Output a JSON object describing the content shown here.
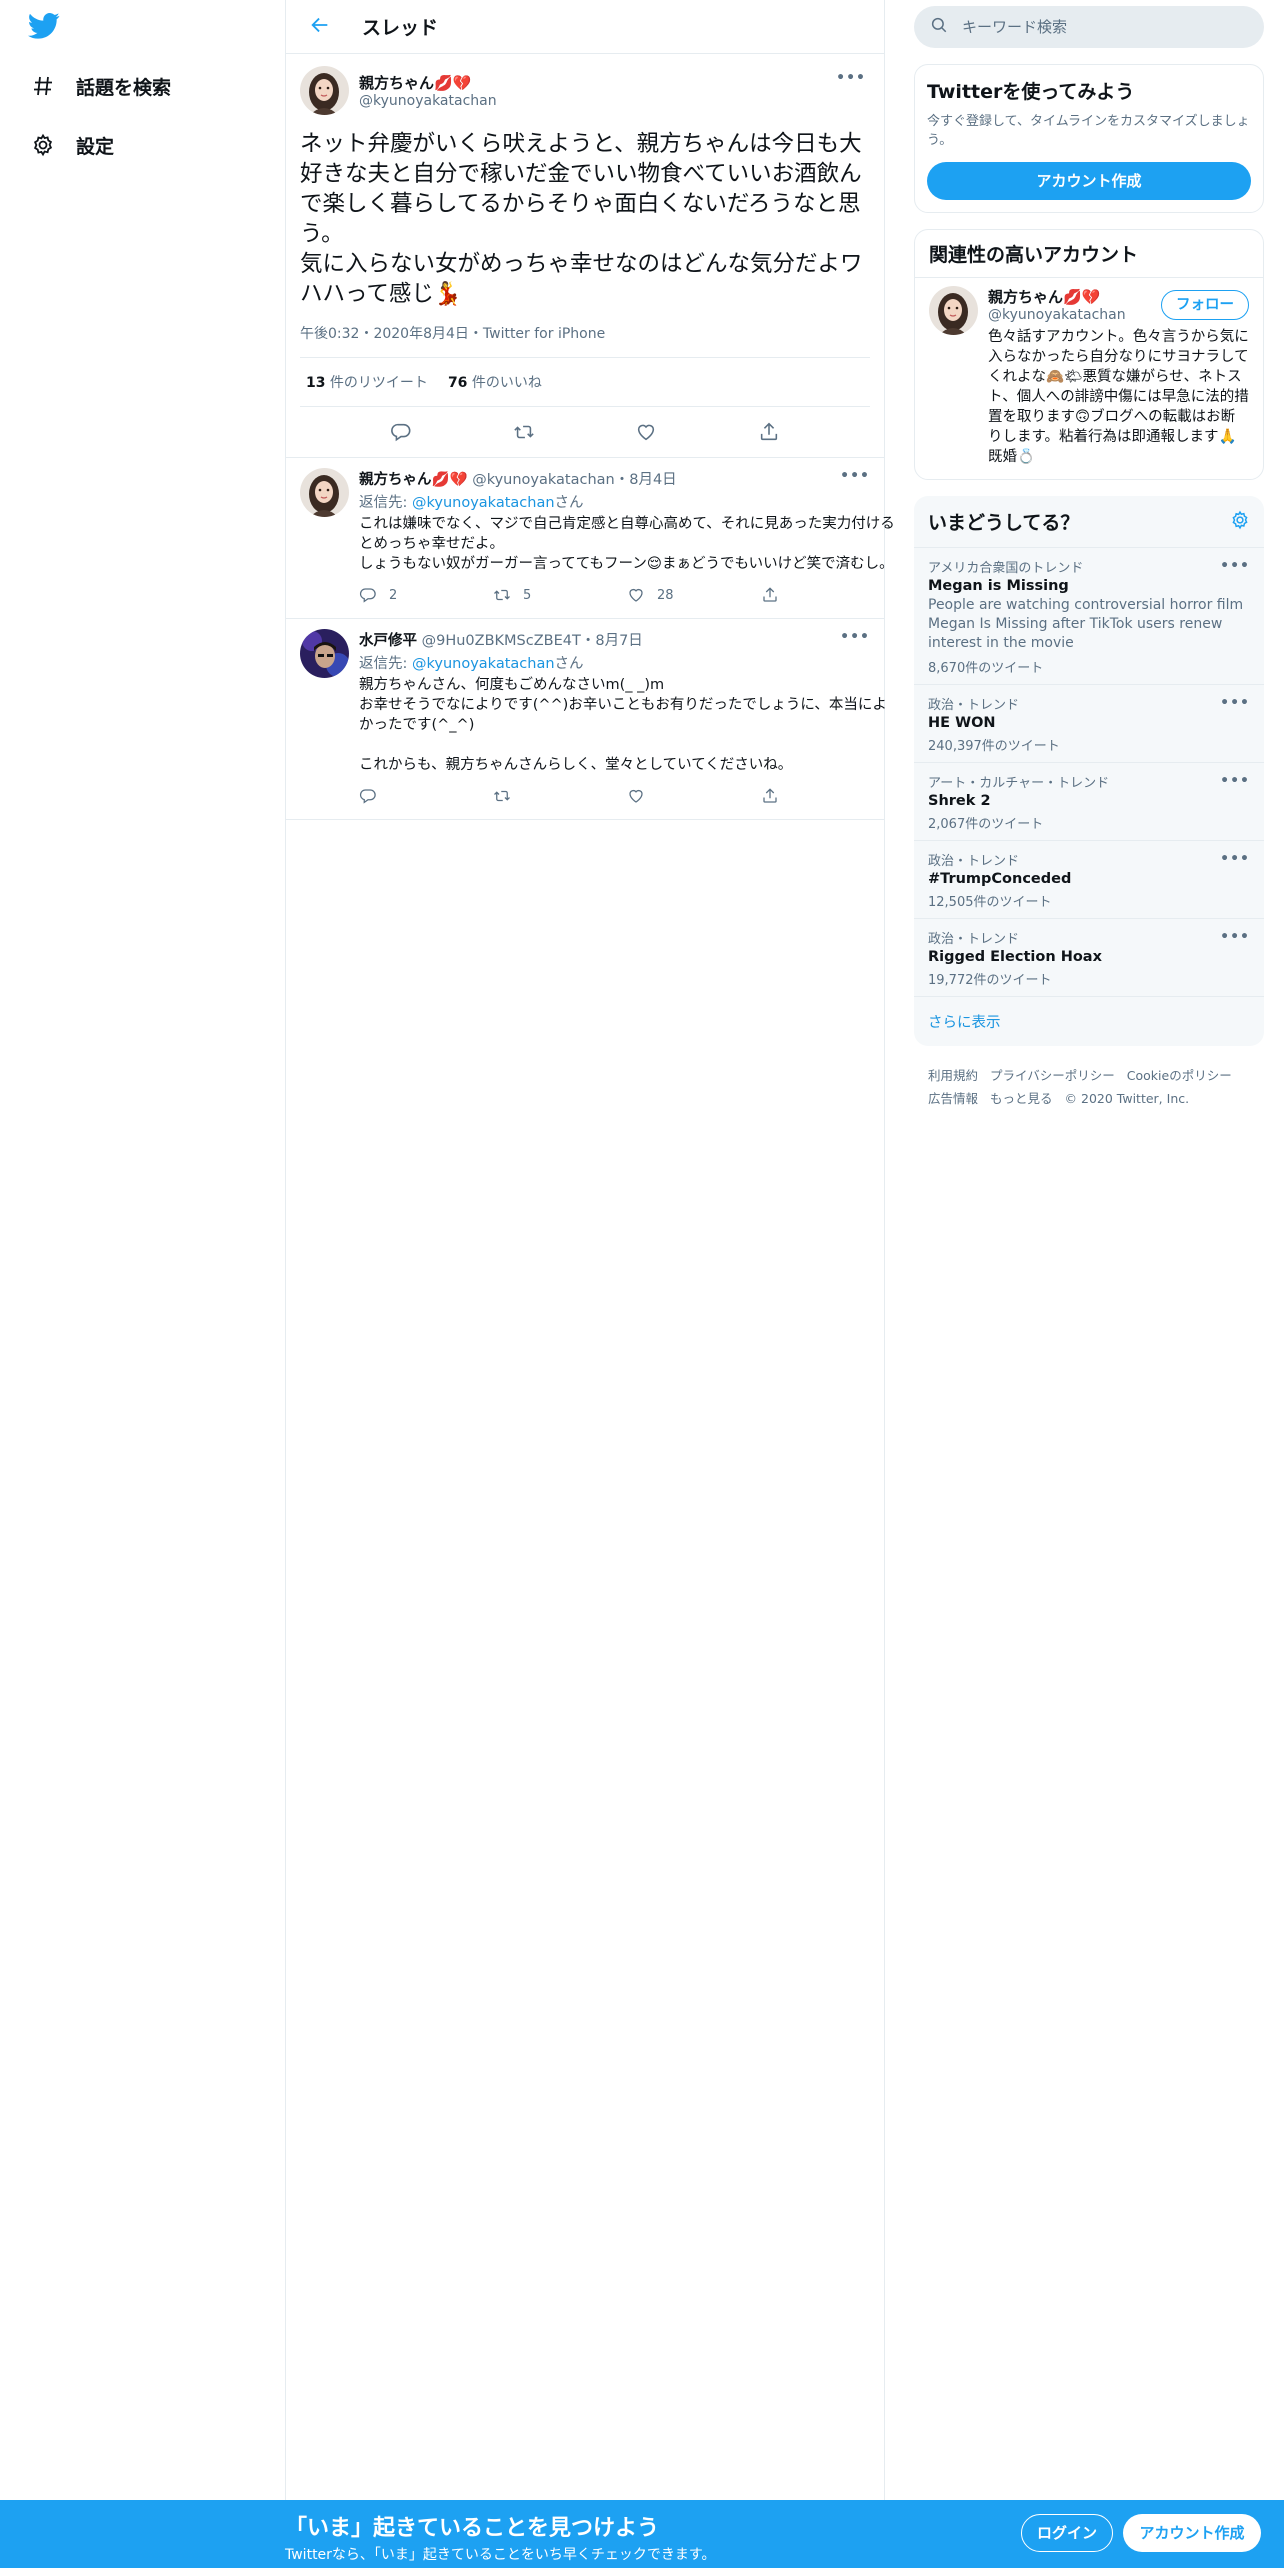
{
  "nav": {
    "logo": "twitter-logo",
    "items": [
      {
        "label": "話題を検索",
        "icon": "hashtag-icon"
      },
      {
        "label": "設定",
        "icon": "gear-icon"
      }
    ]
  },
  "header": {
    "title": "スレッド"
  },
  "main_tweet": {
    "name": "親方ちゃん💋💔",
    "handle": "@kyunoyakatachan",
    "text": "ネット弁慶がいくら吠えようと、親方ちゃんは今日も大好きな夫と自分で稼いだ金でいい物食べていいお酒飲んで楽しく暮らしてるからそりゃ面白くないだろうなと思う。\n気に入らない女がめっちゃ幸せなのはどんな気分だよワハハって感じ💃",
    "meta": "午後0:32・2020年8月4日・Twitter for iPhone",
    "retweets_count": "13",
    "retweets_label": " 件のリツイート",
    "likes_count": "76",
    "likes_label": " 件のいいね"
  },
  "replies": [
    {
      "name": "親方ちゃん💋💔",
      "handle_date": "@kyunoyakatachan・8月4日",
      "reply_prefix": "返信先: ",
      "reply_to": "@kyunoyakatachan",
      "reply_suffix": "さん",
      "text": "これは嫌味でなく、マジで自己肯定感と自尊心高めて、それに見あった実力付けるとめっちゃ幸せだよ。\nしょうもない奴がガーガー言っててもフーン😌まぁどうでもいいけど笑で済むし。",
      "counts": {
        "reply": "2",
        "retweet": "5",
        "like": "28"
      }
    },
    {
      "name": "水戸修平",
      "handle_date": "@9Hu0ZBKMScZBE4T・8月7日",
      "reply_prefix": "返信先: ",
      "reply_to": "@kyunoyakatachan",
      "reply_suffix": "さん",
      "text": "親方ちゃんさん、何度もごめんなさいm(_ _)m\nお幸せそうでなによりです(^^)お辛いこともお有りだったでしょうに、本当によかったです(^_^)\n\nこれからも、親方ちゃんさんらしく、堂々としていてくださいね。",
      "counts": {
        "reply": "",
        "retweet": "",
        "like": ""
      }
    }
  ],
  "search": {
    "placeholder": "キーワード検索"
  },
  "signup_card": {
    "title": "Twitterを使ってみよう",
    "desc": "今すぐ登録して、タイムラインをカスタマイズしましょう。",
    "button": "アカウント作成"
  },
  "related": {
    "title": "関連性の高いアカウント",
    "name": "親方ちゃん💋💔",
    "handle": "@kyunoyakatachan",
    "follow": "フォロー",
    "bio": "色々話すアカウント。色々言うから気に入らなかったら自分なりにサヨナラしてくれよな🙈🌤悪質な嫌がらせ、ネトスト、個人への誹謗中傷には早急に法的措置を取ります🙃ブログへの転載はお断りします。粘着行為は即通報します🙏 既婚💍"
  },
  "trends": {
    "title": "いまどうしてる？",
    "items": [
      {
        "context": "アメリカ合衆国のトレンド",
        "name": "Megan is Missing",
        "desc": "People are watching controversial horror film Megan Is Missing after TikTok users renew interest in the movie",
        "count": "8,670件のツイート"
      },
      {
        "context": "政治・トレンド",
        "name": "HE WON",
        "desc": "",
        "count": "240,397件のツイート"
      },
      {
        "context": "アート・カルチャー・トレンド",
        "name": "Shrek 2",
        "desc": "",
        "count": "2,067件のツイート"
      },
      {
        "context": "政治・トレンド",
        "name": "#TrumpConceded",
        "desc": "",
        "count": "12,505件のツイート"
      },
      {
        "context": "政治・トレンド",
        "name": "Rigged Election Hoax",
        "desc": "",
        "count": "19,772件のツイート"
      }
    ],
    "show_more": "さらに表示"
  },
  "footer": {
    "links": [
      "利用規約",
      "プライバシーポリシー",
      "Cookieのポリシー",
      "広告情報",
      "もっと見る"
    ],
    "copyright": "© 2020 Twitter, Inc."
  },
  "bottom_bar": {
    "title": "「いま」起きていることを見つけよう",
    "subtitle": "Twitterなら、「いま」起きていることをいち早くチェックできます。",
    "login": "ログイン",
    "signup": "アカウント作成"
  },
  "colors": {
    "brand": "#1da1f2",
    "link": "#1b95e0",
    "muted": "#5b7083",
    "border": "#e6ecf0"
  }
}
